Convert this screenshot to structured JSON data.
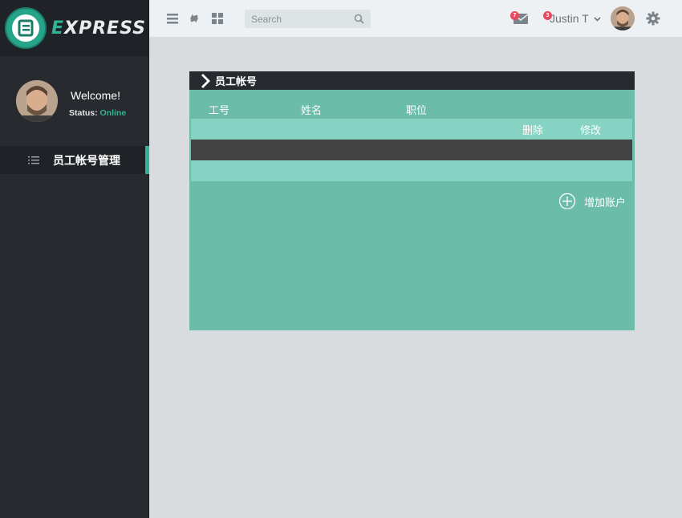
{
  "brand": {
    "logo_letter": "E",
    "name_first": "E",
    "name_rest": "XPRESS"
  },
  "user": {
    "welcome": "Welcome!",
    "status_label": "Status:",
    "status_value": "Online"
  },
  "sidebar": {
    "items": [
      {
        "label": "员工帐号管理",
        "icon": "list-icon",
        "active": true
      }
    ]
  },
  "topbar": {
    "search_placeholder": "Search",
    "mail_badge": "7",
    "user_badge": "3",
    "username": "Justin T"
  },
  "panel": {
    "title": "员工帐号",
    "columns": [
      "工号",
      "姓名",
      "职位"
    ],
    "actions": {
      "delete": "删除",
      "edit": "修改"
    },
    "add_label": "增加账户"
  },
  "colors": {
    "accent": "#2fb596",
    "panel": "#6cbcaa",
    "row_light": "#86d2c3",
    "row_dark": "#434343",
    "sidebar": "#272b30",
    "badge": "#e84a5f"
  }
}
